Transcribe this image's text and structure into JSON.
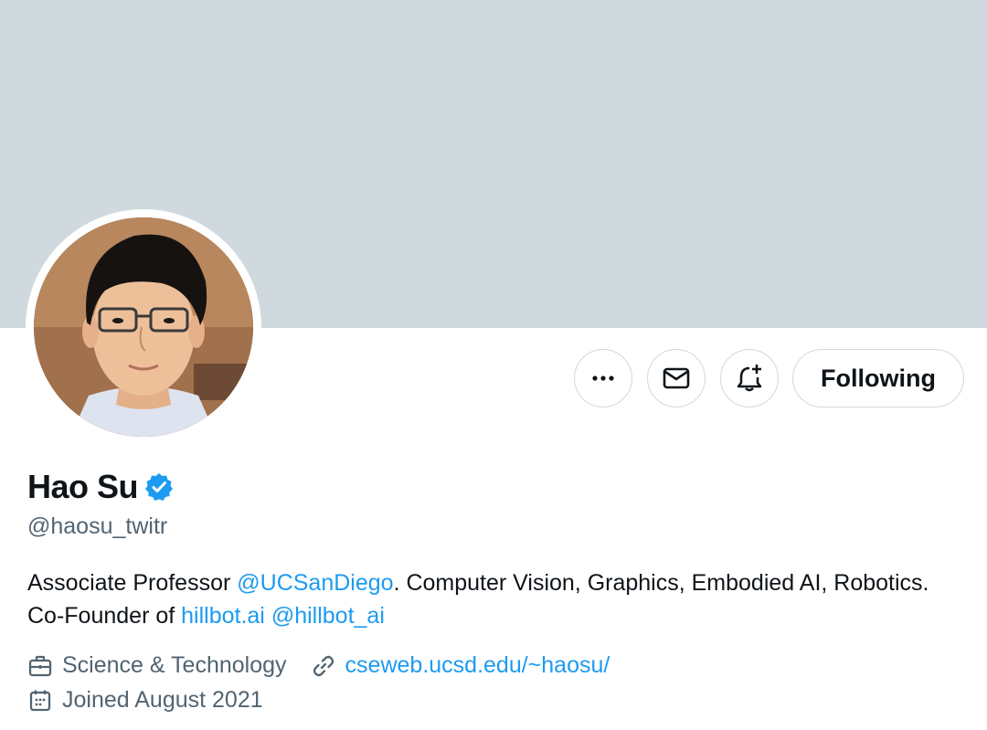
{
  "profile": {
    "display_name": "Hao Su",
    "handle": "@haosu_twitr",
    "verified": true,
    "bio": {
      "part1": "Associate Professor ",
      "mention1": "@UCSanDiego",
      "part2": ". Computer Vision, Graphics, Embodied AI, Robotics. Co-Founder of ",
      "link1": "hillbot.ai",
      "part3": " ",
      "mention2": "@hillbot_ai"
    },
    "category": "Science & Technology",
    "website": "cseweb.ucsd.edu/~haosu/",
    "joined": "Joined August 2021"
  },
  "actions": {
    "following_label": "Following",
    "icons": [
      "more-icon",
      "message-icon",
      "notification-bell-icon"
    ]
  },
  "colors": {
    "banner": "#cfd9de",
    "accent": "#1d9bf0",
    "text_primary": "#0f1419",
    "text_secondary": "#536471",
    "border": "#cfd9de"
  }
}
